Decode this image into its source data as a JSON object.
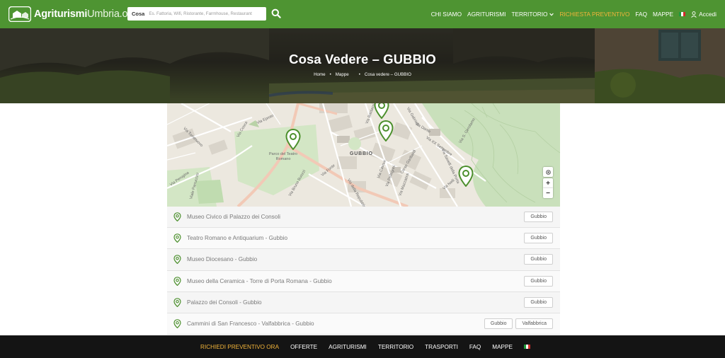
{
  "header": {
    "logo_bold": "Agriturismi",
    "logo_light": "Umbria.org",
    "search_label": "Cosa",
    "search_placeholder": "Es. Fattoria, Wifi, Ristorante, Farmhouse, Restaurant",
    "nav": [
      {
        "label": "CHI SIAMO"
      },
      {
        "label": "AGRITURISMI"
      },
      {
        "label": "TERRITORIO"
      },
      {
        "label": "RICHIESTA PREVENTIVO"
      },
      {
        "label": "FAQ"
      },
      {
        "label": "MAPPE"
      },
      {
        "label": "Accedi"
      }
    ]
  },
  "hero": {
    "title": "Cosa Vedere – GUBBIO",
    "breadcrumb": [
      "Home",
      "Mappe",
      "Cosa vedere – GUBBIO"
    ]
  },
  "map": {
    "town_label": "GUBBIO",
    "labels": [
      "Via Eproto",
      "Via Cosca",
      "Via Torrenuovo",
      "Parco del Teatro Romano",
      "Via Bruno Buozzi",
      "Via Fonte",
      "Via Cavour",
      "Via XX Settembre",
      "Via Dante",
      "Via Baldassini",
      "Via Perugina",
      "Via Mazzatinti",
      "Via Nelli",
      "Via S. Gerolamo",
      "Corso Garibaldi",
      "Via Gabrielli",
      "Via Pellegrini",
      "Via Savelli della Porta",
      "Viale Parruccini",
      "Via della Repubblica"
    ],
    "zoom_in": "+",
    "zoom_out": "−"
  },
  "poi_list": [
    {
      "name": "Museo Civico di Palazzo dei Consoli",
      "tags": [
        "Gubbio"
      ]
    },
    {
      "name": "Teatro Romano e Antiquarium - Gubbio",
      "tags": [
        "Gubbio"
      ]
    },
    {
      "name": "Museo Diocesano - Gubbio",
      "tags": [
        "Gubbio"
      ]
    },
    {
      "name": "Museo della Ceramica - Torre di Porta Romana - Gubbio",
      "tags": [
        "Gubbio"
      ]
    },
    {
      "name": "Palazzo dei Consoli - Gubbio",
      "tags": [
        "Gubbio"
      ]
    },
    {
      "name": "Cammini di San Francesco - Valfabbrica - Gubbio",
      "tags": [
        "Gubbio",
        "Valfabbrica"
      ]
    }
  ],
  "footer": {
    "items": [
      "RICHIEDI PREVENTIVO ORA",
      "OFFERTE",
      "AGRITURISMI",
      "TERRITORIO",
      "TRASPORTI",
      "FAQ",
      "MAPPE"
    ]
  },
  "colors": {
    "brand_green": "#4e9432",
    "accent_orange": "#f2b43a",
    "marker_green": "#4b8f2c",
    "footer_bg": "#141414"
  },
  "icons": {
    "search": "search-icon",
    "chevron": "chevron-down-icon",
    "flag": "italy-flag-icon",
    "user": "user-icon",
    "marker": "map-marker-icon",
    "locate": "locate-icon"
  }
}
